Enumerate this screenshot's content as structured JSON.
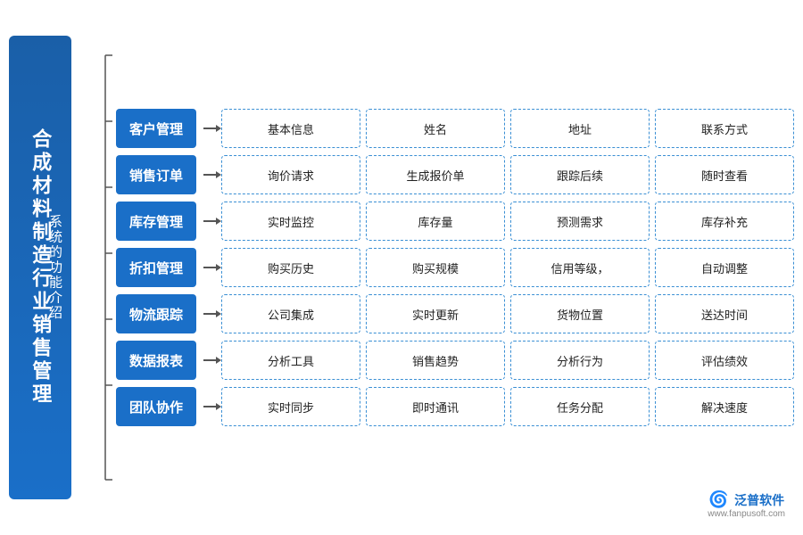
{
  "title": {
    "main": "合成材料制造行业销售管理",
    "sub": "系统的功能介绍"
  },
  "rows": [
    {
      "category": "客户管理",
      "features": [
        "基本信息",
        "姓名",
        "地址",
        "联系方式"
      ]
    },
    {
      "category": "销售订单",
      "features": [
        "询价请求",
        "生成报价单",
        "跟踪后续",
        "随时查看"
      ]
    },
    {
      "category": "库存管理",
      "features": [
        "实时监控",
        "库存量",
        "预测需求",
        "库存补充"
      ]
    },
    {
      "category": "折扣管理",
      "features": [
        "购买历史",
        "购买规模",
        "信用等级，",
        "自动调整"
      ]
    },
    {
      "category": "物流跟踪",
      "features": [
        "公司集成",
        "实时更新",
        "货物位置",
        "送达时间"
      ]
    },
    {
      "category": "数据报表",
      "features": [
        "分析工具",
        "销售趋势",
        "分析行为",
        "评估绩效"
      ]
    },
    {
      "category": "团队协作",
      "features": [
        "实时同步",
        "即时通讯",
        "任务分配",
        "解决速度"
      ]
    }
  ],
  "logo": {
    "name": "泛普软件",
    "url": "www.fanpusoft.com"
  }
}
